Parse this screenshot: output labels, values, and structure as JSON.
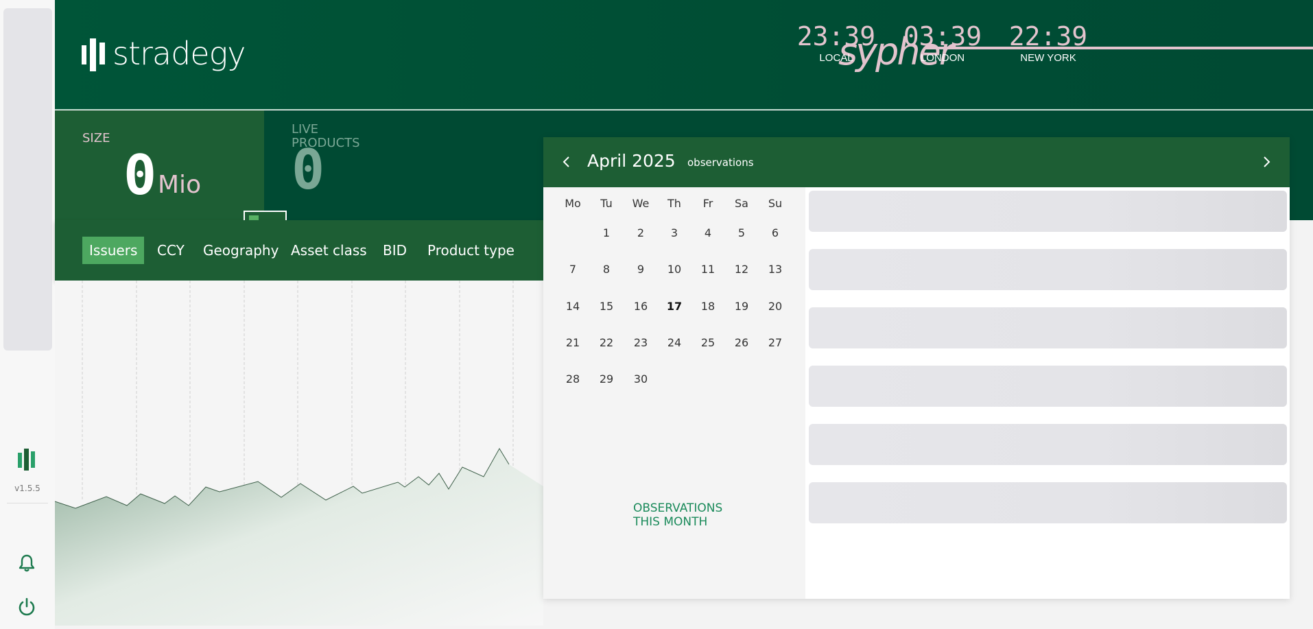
{
  "brand": {
    "name": "stradegy",
    "partner": "sypher"
  },
  "clocks": [
    {
      "time": "23:39",
      "label": "LOCAL"
    },
    {
      "time": "03:39",
      "label": "LONDON"
    },
    {
      "time": "22:39",
      "label": "NEW YORK"
    }
  ],
  "stats": {
    "size_label": "SIZE",
    "size_value": "0",
    "size_unit": "Mio",
    "live_label": "LIVE PRODUCTS",
    "live_value": "0"
  },
  "filters": [
    "Issuers",
    "CCY",
    "Geography",
    "Asset class",
    "BID",
    "Product type"
  ],
  "active_filter": "Issuers",
  "rail": {
    "version": "v1.5.5"
  },
  "calendar": {
    "month": "April 2025",
    "subtitle": "observations",
    "weekdays": [
      "Mo",
      "Tu",
      "We",
      "Th",
      "Fr",
      "Sa",
      "Su"
    ],
    "weeks": [
      [
        "",
        "1",
        "2",
        "3",
        "4",
        "5",
        "6"
      ],
      [
        "7",
        "8",
        "9",
        "10",
        "11",
        "12",
        "13"
      ],
      [
        "14",
        "15",
        "16",
        "17",
        "18",
        "19",
        "20"
      ],
      [
        "21",
        "22",
        "23",
        "24",
        "25",
        "26",
        "27"
      ],
      [
        "28",
        "29",
        "30",
        "",
        "",
        "",
        ""
      ]
    ],
    "today": "17",
    "observations_line1": "OBSERVATIONS",
    "observations_line2": "THIS MONTH"
  },
  "colors": {
    "header_bg": "#005538",
    "panel_green": "#1d5e34",
    "accent_green": "#4da860",
    "pink": "#e3c4ce"
  }
}
